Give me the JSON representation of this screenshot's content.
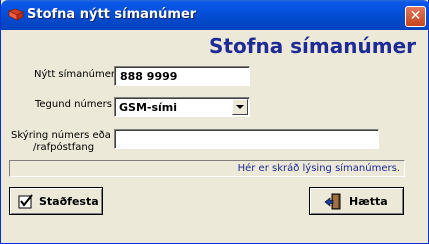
{
  "window": {
    "title": "Stofna nýtt símanúmer"
  },
  "icons": {
    "title": "app-book-icon",
    "close": "close-icon",
    "dropdown": "chevron-down-icon",
    "confirm": "checkmark-icon",
    "cancel": "exit-door-icon"
  },
  "colors": {
    "heading": "#1e2a96",
    "titlebar": "#0350d9"
  },
  "form": {
    "heading": "Stofna símanúmer",
    "number_label": "Nýtt símanúmer",
    "number_value": "888 9999",
    "type_label": "Tegund númers",
    "type_value": "GSM-sími",
    "desc_label_line1": "Skýring númers  eða",
    "desc_label_line2": "/rafpóstfang",
    "desc_value": ""
  },
  "status": {
    "text": "Hér er skráð lýsing símanúmers."
  },
  "buttons": {
    "confirm_label": "Staðfesta",
    "cancel_label": "Hætta"
  }
}
